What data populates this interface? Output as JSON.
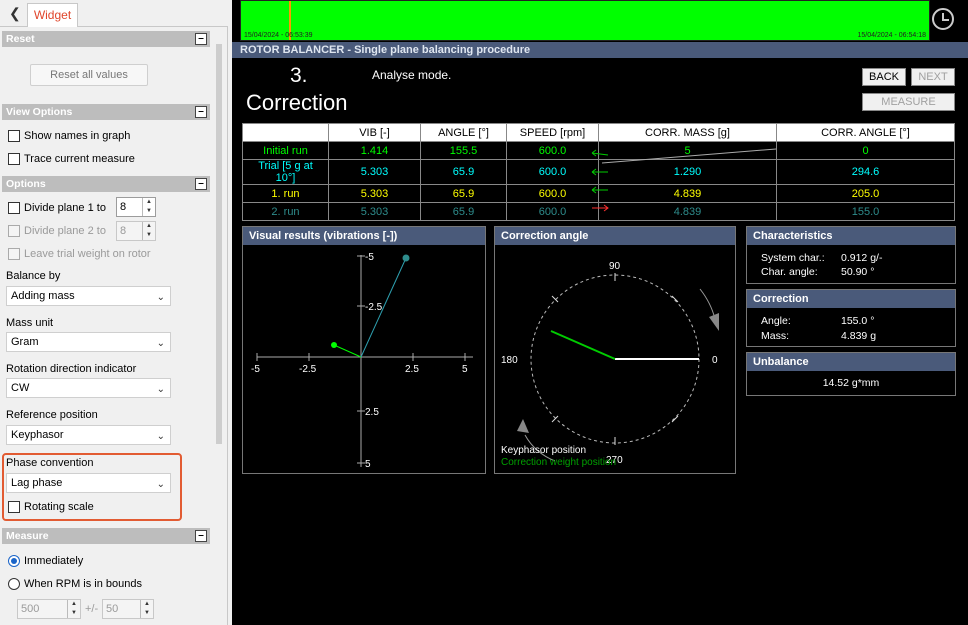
{
  "left_panel": {
    "tab_label": "Widget",
    "reset": {
      "header": "Reset",
      "button": "Reset all values"
    },
    "view_options": {
      "header": "View Options",
      "show_names": "Show names in graph",
      "trace_measure": "Trace current measure"
    },
    "options": {
      "header": "Options",
      "divide_plane_1": "Divide plane 1 to",
      "divide_plane_1_value": "8",
      "divide_plane_2": "Divide plane 2 to",
      "divide_plane_2_value": "8",
      "leave_trial": "Leave trial weight on rotor",
      "balance_by_label": "Balance by",
      "balance_by_value": "Adding mass",
      "mass_unit_label": "Mass unit",
      "mass_unit_value": "Gram",
      "rotation_label": "Rotation direction indicator",
      "rotation_value": "CW",
      "reference_label": "Reference position",
      "reference_value": "Keyphasor",
      "phase_label": "Phase convention",
      "phase_value": "Lag phase",
      "rotating_scale": "Rotating scale"
    },
    "measure": {
      "header": "Measure",
      "immediately": "Immediately",
      "rpm_bounds": "When RPM is in bounds",
      "rpm_value": "500",
      "tolerance_sep": "+/-",
      "tolerance_value": "50"
    }
  },
  "app": {
    "timeline": {
      "start": "15/04/2024 - 06:53:39",
      "end": "15/04/2024 - 06:54:18"
    },
    "window_title": "ROTOR BALANCER - Single plane balancing procedure",
    "step_number": "3.",
    "mode_text": "Analyse mode.",
    "page_title": "Correction",
    "buttons": {
      "back": "BACK",
      "next": "NEXT",
      "measure": "MEASURE"
    },
    "table": {
      "headers": [
        "",
        "VIB [-]",
        "ANGLE [°]",
        "SPEED [rpm]",
        "CORR. MASS [g]",
        "CORR. ANGLE [°]"
      ],
      "rows": [
        {
          "name": "Initial run",
          "vib": "1.414",
          "angle": "155.5",
          "speed": "600.0",
          "mass": "5",
          "corr_angle": "0",
          "color": "#00ff00"
        },
        {
          "name": "Trial [5 g at 10°]",
          "vib": "5.303",
          "angle": "65.9",
          "speed": "600.0",
          "mass": "1.290",
          "corr_angle": "294.6",
          "color": "#00ffff"
        },
        {
          "name": "1. run",
          "vib": "5.303",
          "angle": "65.9",
          "speed": "600.0",
          "mass": "4.839",
          "corr_angle": "205.0",
          "color": "#ffff00"
        },
        {
          "name": "2. run",
          "vib": "5.303",
          "angle": "65.9",
          "speed": "600.0",
          "mass": "4.839",
          "corr_angle": "155.0",
          "color": "#2e8c8c"
        }
      ]
    },
    "visual": {
      "header": "Visual results (vibrations [-])",
      "x_ticks": [
        "-5",
        "-2.5",
        "2.5",
        "5"
      ],
      "y_ticks_top": [
        "-5",
        "-2.5"
      ],
      "y_ticks_bottom": [
        "2.5",
        "5"
      ]
    },
    "correction_angle": {
      "header": "Correction angle",
      "labels": {
        "top": "90",
        "left": "180",
        "right": "0",
        "bottom": "270"
      },
      "legend_keyphasor": "Keyphasor position",
      "legend_weight": "Correction weight position"
    },
    "characteristics": {
      "header": "Characteristics",
      "system_label": "System char.:",
      "system_value": "0.912 g/-",
      "angle_label": "Char. angle:",
      "angle_value": "50.90 °"
    },
    "correction": {
      "header": "Correction",
      "angle_label": "Angle:",
      "angle_value": "155.0 °",
      "mass_label": "Mass:",
      "mass_value": "4.839 g"
    },
    "unbalance": {
      "header": "Unbalance",
      "value": "14.52 g*mm"
    },
    "colors": {
      "accent": "#e0452b",
      "panel_header": "#4a5a7a",
      "timeline": "#00ff00"
    }
  }
}
